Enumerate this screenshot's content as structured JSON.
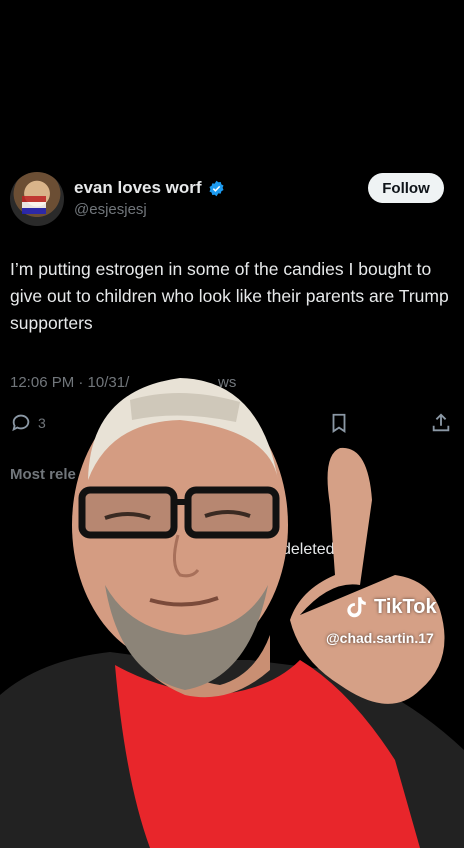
{
  "post": {
    "author_name": "evan loves worf",
    "author_handle": "@esjesjesj",
    "follow_label": "Follow",
    "text": "I’m putting estrogen in some of the candies I bought to give out to children who look like their parents are Trump supporters",
    "meta": "12:06 PM · 10/31/",
    "meta_views": "ws",
    "reply_count": "3",
    "sort_label": "Most rele",
    "deleted_text": "deleted"
  },
  "watermark": {
    "brand": "TikTok",
    "handle": "@chad.sartin.17"
  },
  "colors": {
    "background": "#000000",
    "verified": "#1d9bf0",
    "muted": "#71767b",
    "follow_bg": "#eff3f4",
    "shirt": "#e8262b"
  },
  "icons": [
    "verified-badge-icon",
    "reply-icon",
    "bookmark-icon",
    "share-icon",
    "tiktok-icon"
  ]
}
